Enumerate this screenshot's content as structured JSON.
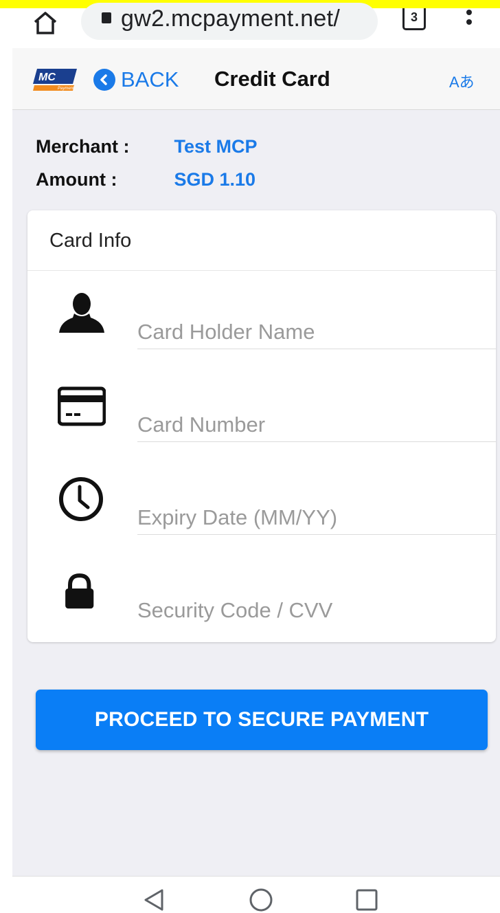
{
  "browser": {
    "url": "gw2.mcpayment.net/",
    "tab_count": "3",
    "icons": [
      "home-icon",
      "lock-icon",
      "tab-switcher-icon",
      "overflow-menu-icon"
    ]
  },
  "header": {
    "logo_text": "MC",
    "logo_subtext": "Payment",
    "back_label": "BACK",
    "title": "Credit Card",
    "lang_label": "Aあ"
  },
  "summary": {
    "merchant_label": "Merchant :",
    "merchant_value": "Test MCP",
    "amount_label": "Amount :",
    "amount_value": "SGD 1.10"
  },
  "card_info": {
    "heading": "Card Info",
    "fields": [
      {
        "icon": "person-icon",
        "placeholder": "Card Holder Name",
        "value": ""
      },
      {
        "icon": "credit-card-icon",
        "placeholder": "Card Number",
        "value": ""
      },
      {
        "icon": "clock-icon",
        "placeholder": "Expiry Date (MM/YY)",
        "value": ""
      },
      {
        "icon": "lock-icon",
        "placeholder": "Security Code / CVV",
        "value": ""
      }
    ]
  },
  "submit_label": "PROCEED TO SECURE PAYMENT",
  "colors": {
    "accent": "#1a7ae8",
    "button": "#0a7ef6",
    "page_bg": "#efeff4",
    "top_strip": "#ffff00"
  }
}
